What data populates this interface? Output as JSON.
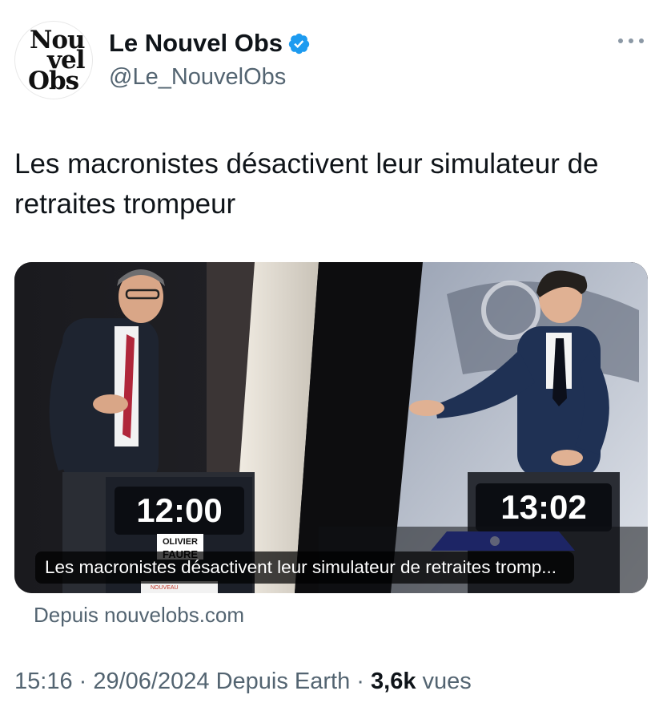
{
  "account": {
    "display_name": "Le Nouvel Obs",
    "handle": "@Le_NouvelObs",
    "verified": true,
    "verified_color": "#1d9bf0",
    "avatar_logo": [
      "Nou",
      "vel",
      "Obs"
    ],
    "avatar_icon": "nouvel-obs-logo"
  },
  "tweet": {
    "text": "Les macronistes désactivent leur simulateur de retraites trompeur"
  },
  "link_card": {
    "overlay_title": "Les macronistes désactivent leur simulateur de retraites tromp...",
    "source_label": "Depuis nouvelobs.com",
    "image": {
      "left_timer": "12:00",
      "right_timer": "13:02",
      "nameplate_first": "OLIVIER",
      "nameplate_last": "FAURE",
      "banner_text": "NOUVEAU"
    }
  },
  "meta": {
    "time": "15:16",
    "separator": " · ",
    "date": "29/06/2024",
    "source": "Depuis Earth",
    "views_count": "3,6k",
    "views_label": "vues"
  },
  "icons": {
    "more": "more-horizontal-icon",
    "verified": "verified-badge-icon"
  }
}
